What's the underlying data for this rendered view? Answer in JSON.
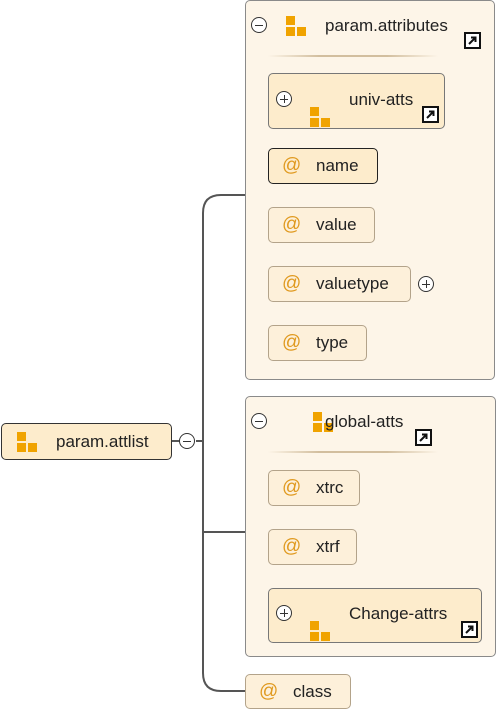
{
  "root": {
    "label": "param.attlist",
    "collapse_state": "expanded"
  },
  "groups": [
    {
      "title": "param.attributes",
      "collapse_state": "expanded",
      "children": [
        {
          "kind": "element-ref",
          "label": "univ-atts",
          "collapse_state": "collapsed"
        },
        {
          "kind": "attribute",
          "label": "name",
          "emphasis": "required"
        },
        {
          "kind": "attribute",
          "label": "value"
        },
        {
          "kind": "attribute",
          "label": "valuetype",
          "collapse_state": "collapsed"
        },
        {
          "kind": "attribute",
          "label": "type"
        }
      ]
    },
    {
      "title": "global-atts",
      "collapse_state": "expanded",
      "children": [
        {
          "kind": "attribute",
          "label": "xtrc"
        },
        {
          "kind": "attribute",
          "label": "xtrf"
        },
        {
          "kind": "element-ref",
          "label": "Change-attrs",
          "collapse_state": "collapsed"
        }
      ]
    }
  ],
  "extra_attribute": {
    "label": "class",
    "at_symbol": "@"
  },
  "symbols": {
    "attribute": "@"
  },
  "colors": {
    "group_fill": "#fdf5e8",
    "node_fill": "#fdeccc",
    "attribute_fill": "#fdf0da",
    "icon_orange": "#f0a300",
    "at_orange": "#e09a20"
  }
}
